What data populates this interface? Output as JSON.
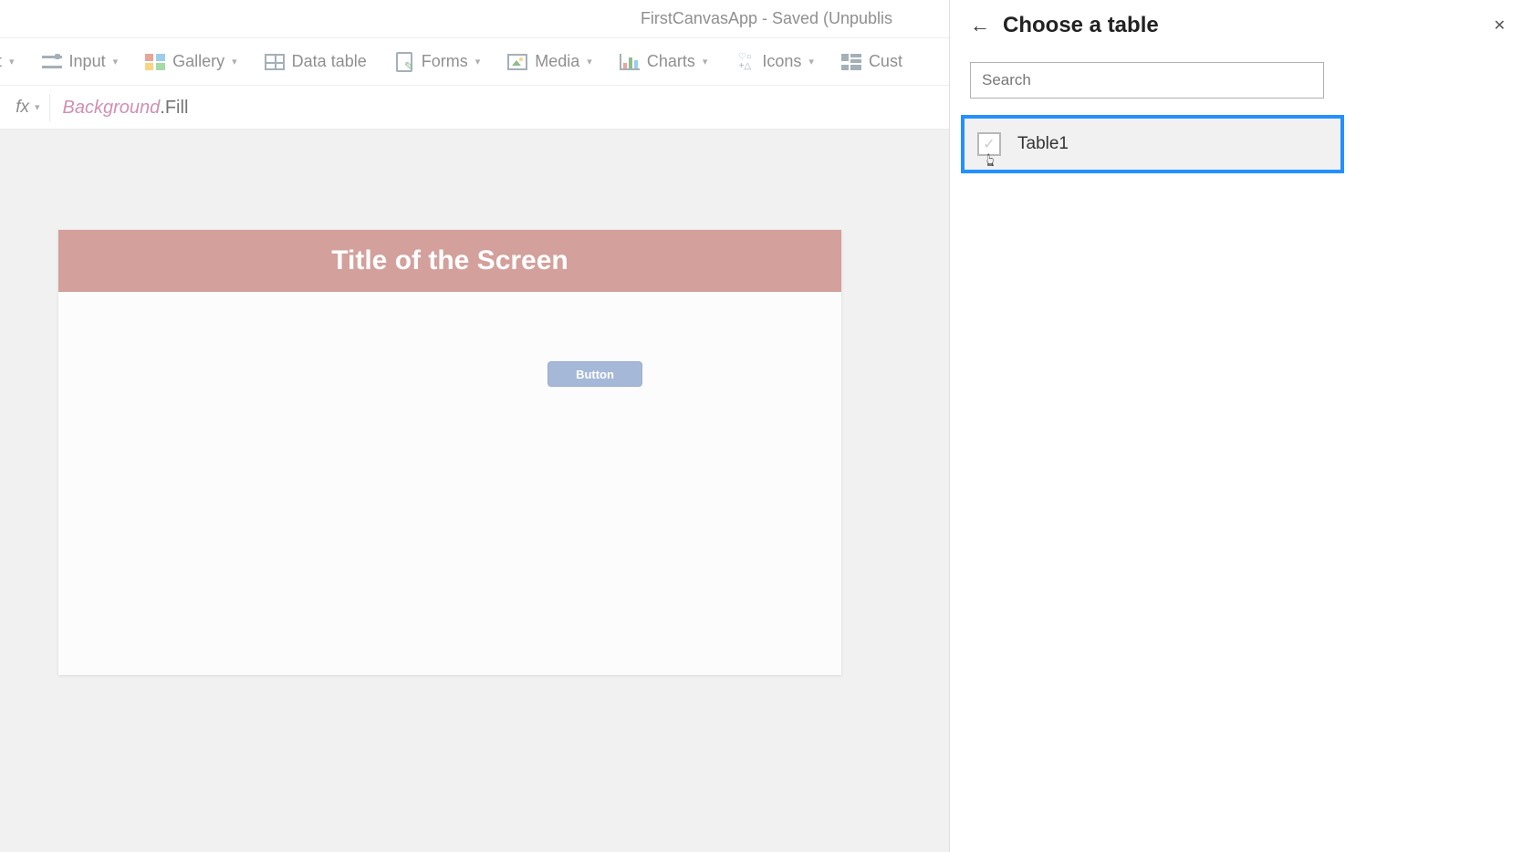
{
  "app_title": "FirstCanvasApp - Saved (Unpublis",
  "ribbon": {
    "text": {
      "label": "ext"
    },
    "input": {
      "label": "Input"
    },
    "gallery": {
      "label": "Gallery"
    },
    "datatable": {
      "label": "Data table"
    },
    "forms": {
      "label": "Forms"
    },
    "media": {
      "label": "Media"
    },
    "charts": {
      "label": "Charts"
    },
    "icons": {
      "label": "Icons"
    },
    "custom": {
      "label": "Cust"
    }
  },
  "formula_bar": {
    "fx_label": "fx",
    "identifier": "Background",
    "property": ".Fill"
  },
  "canvas": {
    "screen_title": "Title of the Screen",
    "button_label": "Button"
  },
  "panel": {
    "title": "Choose a table",
    "search_placeholder": "Search",
    "tables": [
      {
        "name": "Table1"
      }
    ]
  }
}
